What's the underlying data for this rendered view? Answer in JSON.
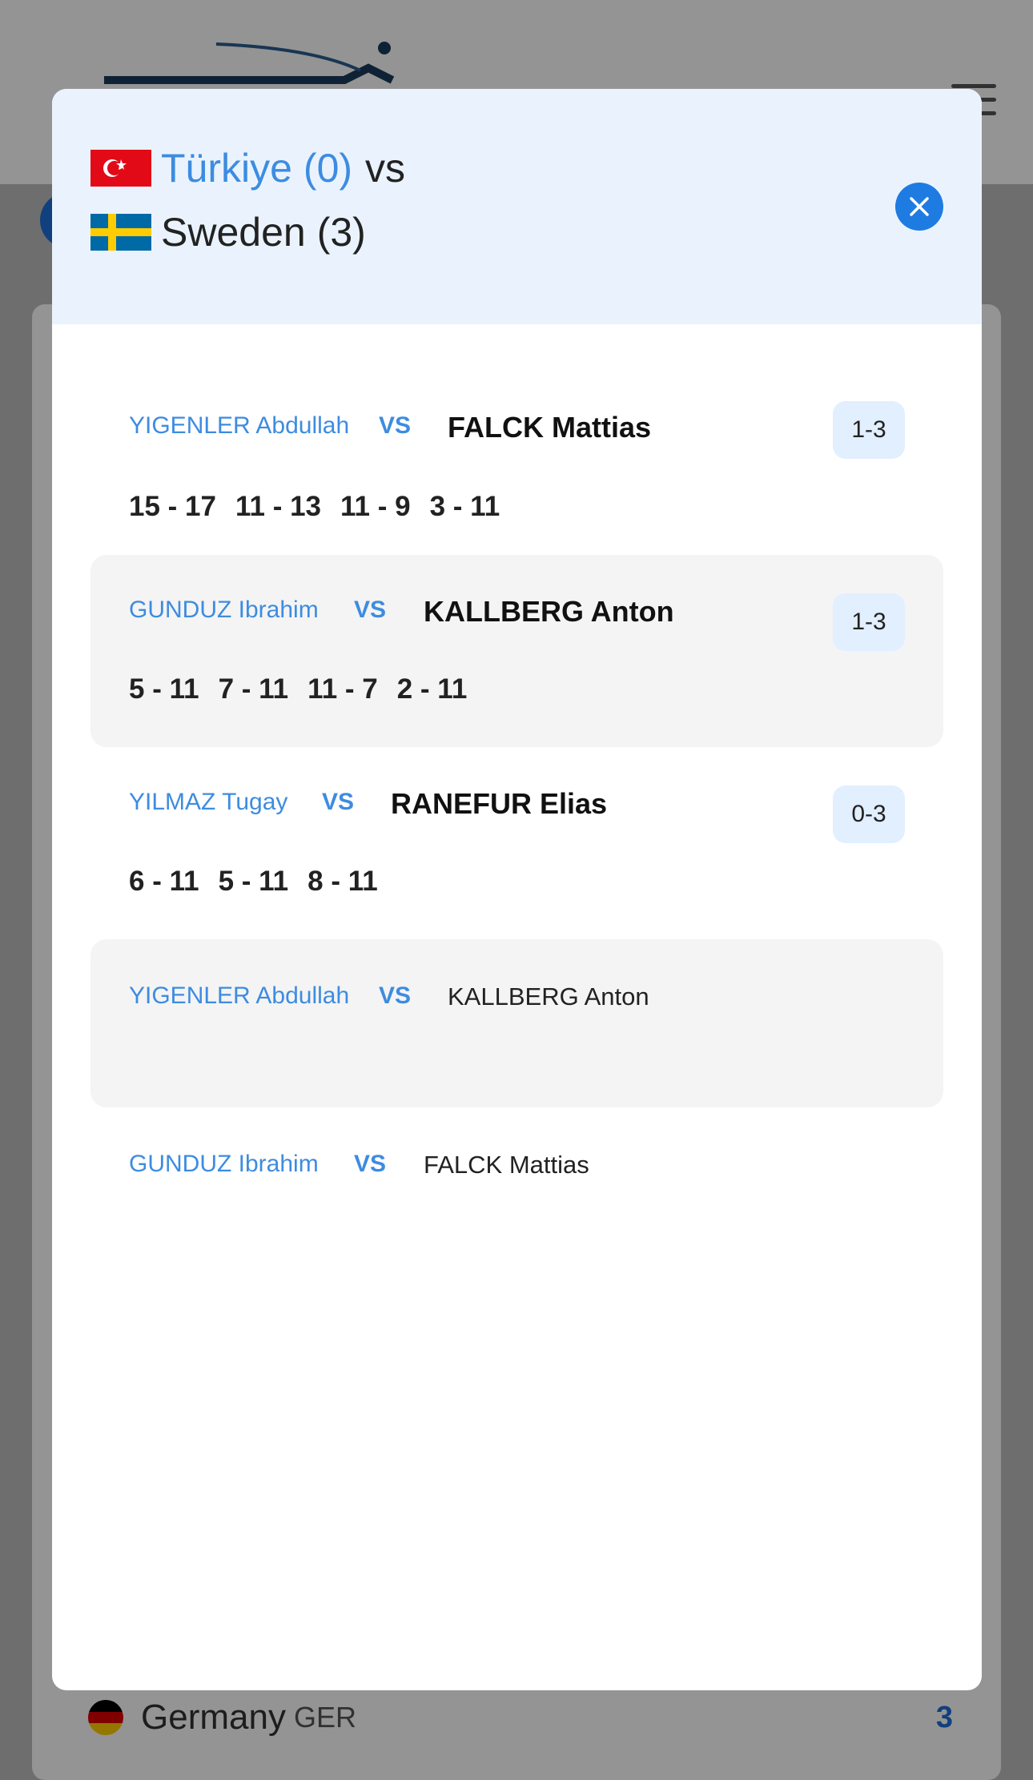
{
  "background": {
    "row": {
      "country": "Germany",
      "code": "GER",
      "score": "3"
    },
    "colors": {
      "header_bg": "#ffffff",
      "accent": "#1e6fd9"
    }
  },
  "modal": {
    "team_home": {
      "name": "Türkiye",
      "score_text": "(0)",
      "flag": "turkey-flag-icon"
    },
    "vs_text": "vs",
    "team_away": {
      "name": "Sweden",
      "score_text": "(3)",
      "flag": "sweden-flag-icon"
    },
    "close_icon": "close-icon",
    "matches": [
      {
        "player_home": "YIGENLER Abdullah",
        "vs": "VS",
        "player_away": "FALCK Mattias",
        "result": "1-3",
        "games": [
          "15 - 17",
          "11 - 13",
          "11 - 9",
          "3 - 11"
        ]
      },
      {
        "player_home": "GUNDUZ Ibrahim",
        "vs": "VS",
        "player_away": "KALLBERG Anton",
        "result": "1-3",
        "games": [
          "5 - 11",
          "7 - 11",
          "11 - 7",
          "2 - 11"
        ]
      },
      {
        "player_home": "YILMAZ Tugay",
        "vs": "VS",
        "player_away": "RANEFUR Elias",
        "result": "0-3",
        "games": [
          "6 - 11",
          "5 - 11",
          "8 - 11"
        ]
      },
      {
        "player_home": "YIGENLER Abdullah",
        "vs": "VS",
        "player_away": "KALLBERG Anton",
        "result": "",
        "games": []
      },
      {
        "player_home": "GUNDUZ Ibrahim",
        "vs": "VS",
        "player_away": "FALCK Mattias",
        "result": "",
        "games": []
      }
    ],
    "colors": {
      "header_bg": "#eaf3fd",
      "home_text": "#3d8ce0",
      "close_button": "#1e7be2",
      "badge_bg": "#e1efff",
      "row_shade": "#f4f4f4"
    }
  }
}
